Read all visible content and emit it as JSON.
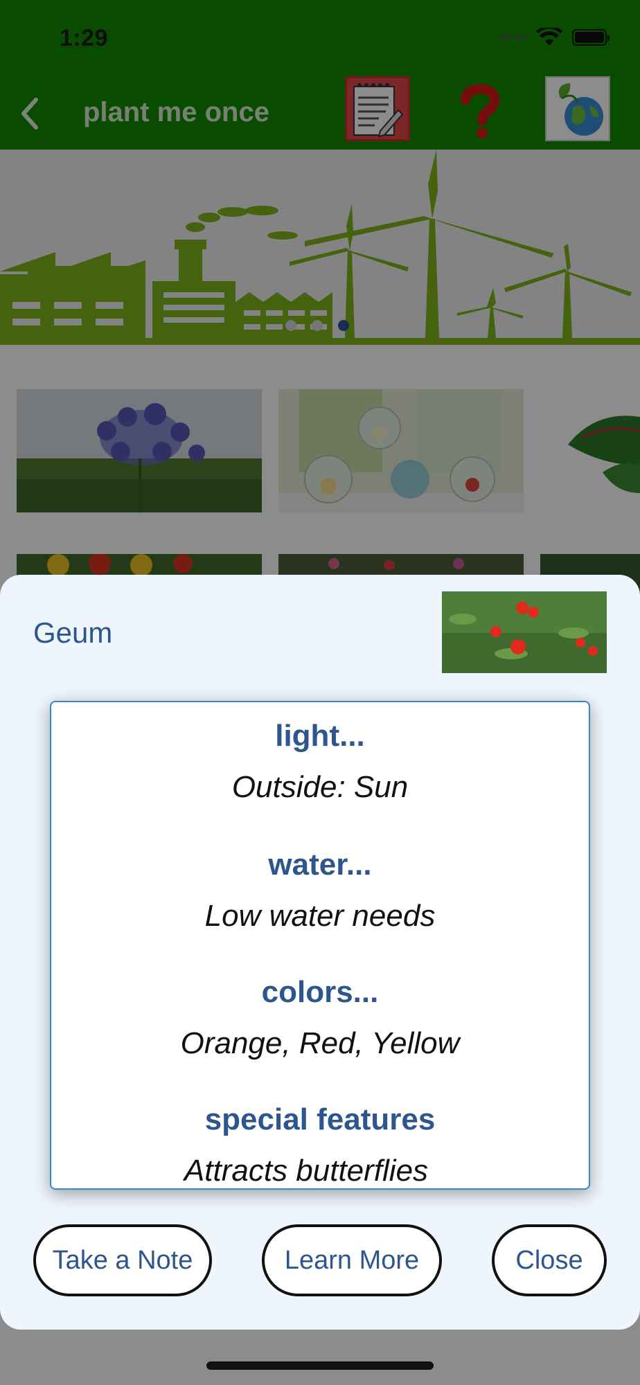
{
  "status_bar": {
    "time": "1:29"
  },
  "nav": {
    "title": "plant me once"
  },
  "banner": {
    "pages": 3,
    "active_page": 3
  },
  "sheet": {
    "plant_name": "Geum",
    "sections": [
      {
        "heading": "light...",
        "value": "Outside: Sun"
      },
      {
        "heading": "water...",
        "value": "Low water needs"
      },
      {
        "heading": "colors...",
        "value": "Orange, Red, Yellow"
      },
      {
        "heading": "special features",
        "value": "Attracts butterflies"
      }
    ],
    "buttons": {
      "take_note": "Take a Note",
      "learn_more": "Learn More",
      "close": "Close"
    }
  },
  "colors": {
    "nav_green": "#118b00",
    "accent_blue": "#2e568e",
    "sheet_bg": "#eef5fc",
    "box_border": "#3a86c8"
  }
}
